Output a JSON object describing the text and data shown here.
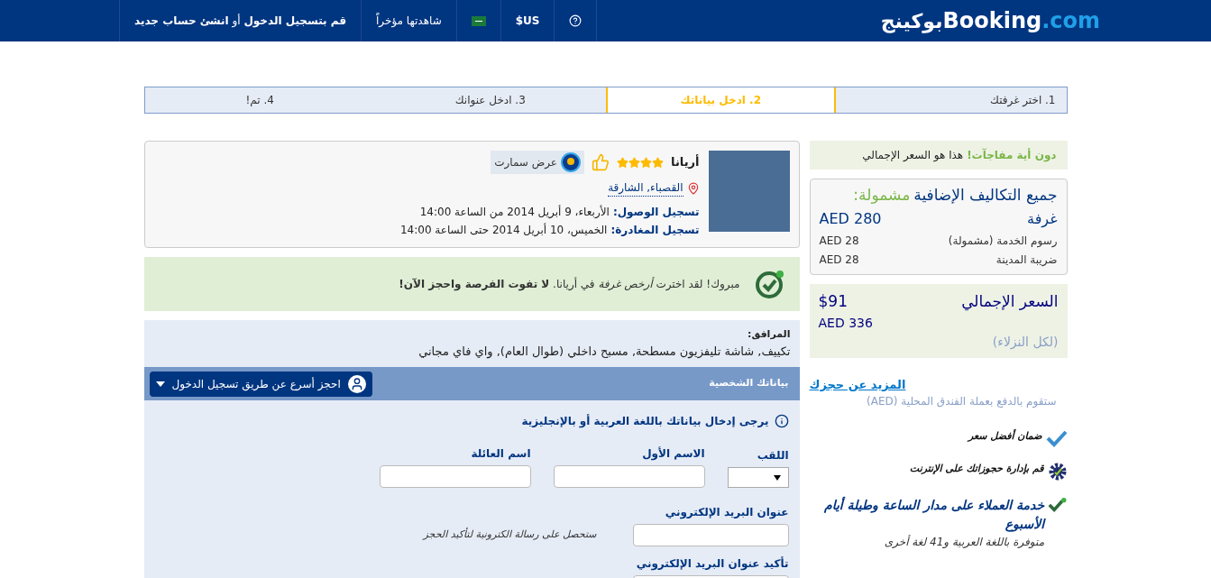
{
  "header": {
    "logo": {
      "name": "Booking",
      "suffix": ".com",
      "arabic": "بوكينج"
    },
    "nav": [
      {
        "kind": "help"
      },
      {
        "kind": "text",
        "label": "$US"
      },
      {
        "kind": "flag"
      },
      {
        "kind": "text",
        "label": "شاهدتها مؤخراً"
      },
      {
        "kind": "rich",
        "label": "**قم بتسجيل الدخول** أو **انشئ حساب جديد**"
      }
    ]
  },
  "steps": [
    {
      "label": "1. اختر غرفتك",
      "selected": false
    },
    {
      "label": "2. ادخل بياناتك",
      "selected": true
    },
    {
      "label": "3. ادخل عنوانك",
      "selected": false
    },
    {
      "label": "4. تم!",
      "selected": false
    }
  ],
  "hotel": {
    "name": "أريانا",
    "stars": 4,
    "deal": "عرض سمارت",
    "location": "القصباء, الشارقة",
    "dates": [
      {
        "label": "تسجيل الوصول:",
        "value": "الأربعاء، 9 أبريل 2014 من الساعة 14:00"
      },
      {
        "label": "تسجيل المغادرة:",
        "value": "الخميس، 10 أبريل 2014 حتى الساعة 14:00"
      }
    ]
  },
  "banner": "مبروك! لقد اخترت *أرخص غرفة* في أريانا. **لا تفوت الفرصة واحجز الآن!**",
  "amenities": {
    "label": "المرافق:",
    "text": "تكييف, شاشة تليفزيون مسطحة, مسبح داخلي (طوال العام), واي فاي مجاني"
  },
  "form": {
    "title": "بياناتك الشخصية",
    "login_button": "احجز أسرع عن طريق تسجيل الدخول",
    "info": "يرجى إدخال بياناتك باللغة العربية أو بالإنجليزية",
    "name_fields": [
      {
        "kind": "select",
        "label": "اللقب"
      },
      {
        "kind": "text",
        "label": "الاسم الأول"
      },
      {
        "kind": "text",
        "label": "اسم العائلة"
      }
    ],
    "email": {
      "label": "عنوان البريد الإلكتروني",
      "hint": "ستحصل على رسالة الكترونية لتأكيد الحجز"
    },
    "confirm_email": {
      "label": "تأكيد عنوان البريد الإلكتروني"
    }
  },
  "sidebar": {
    "notice": {
      "highlight": "دون أية مفاجآت!",
      "text": "هذا هو السعر الإجمالي"
    },
    "costs": {
      "title": "جميع التكاليف الإضافية",
      "included": "مشمولة:",
      "rows": [
        {
          "kind": "main",
          "label": "غرفة",
          "amount": "AED 280"
        },
        {
          "kind": "detail",
          "label": "رسوم الخدمة (مشمولة)",
          "amount": "AED 28"
        },
        {
          "kind": "detail",
          "label": "ضريبة المدينة",
          "amount": "AED 28"
        }
      ]
    },
    "total": {
      "label": "السعر الإجمالي",
      "usd": "$91",
      "local": "AED 336",
      "note": "(لكل النزلاء)"
    },
    "more_link": "المزيد عن حجزك",
    "currency_note": "ستقوم بالدفع بعملة الفندق المحلية (AED)",
    "features": [
      {
        "kind": "check",
        "title": "ضمان أفضل سعر"
      },
      {
        "kind": "gear",
        "title": "قم بإدارة حجوزاتك على الإنترنت"
      },
      {
        "kind": "support",
        "title": "خدمة العملاء على مدار الساعة وطيلة أيام الأسبوع",
        "subtitle": "متوفرة باللغة العربية و41 لغة أخرى"
      }
    ]
  }
}
